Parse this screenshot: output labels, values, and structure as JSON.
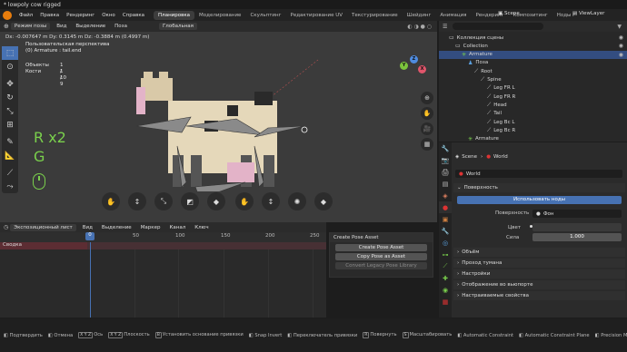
{
  "window": {
    "title": "* lowpoly cow rigged"
  },
  "menu": {
    "items": [
      "Файл",
      "Правка",
      "Рендеринг",
      "Окно",
      "Справка"
    ],
    "workspaces": [
      "Планировка",
      "Моделирование",
      "Скульптинг",
      "Редактирование UV",
      "Текстурирование",
      "Шейдинг",
      "Анимация",
      "Рендеринг",
      "Композитинг",
      "Ноды г"
    ],
    "active_workspace": "Планировка",
    "scene": "Scene",
    "view_layer": "ViewLayer"
  },
  "viewport": {
    "mode": "Режим позы",
    "menus": [
      "Вид",
      "Выделение",
      "Поза"
    ],
    "orientation": "Глобальная",
    "coords": "Dx: -0.007647 m   Dy: 0.3145 m  Dz: -0.3884 m (0.4997 m)",
    "perspective": "Пользовательская перспектива",
    "active": "(0) Armature : tail.end",
    "stats": [
      {
        "label": "Объекты",
        "value": "1 / 10"
      },
      {
        "label": "Кости",
        "value": "1 / 9"
      }
    ],
    "overlay_keys": [
      "R x2",
      "G"
    ],
    "gizmo_axes": [
      "X",
      "Y",
      "Z"
    ]
  },
  "timeline": {
    "menus": [
      "Экспозиционный лист",
      "Вид",
      "Выделение",
      "Маркер",
      "Канал",
      "Ключ"
    ],
    "frame_current": "0",
    "ruler_ticks": [
      "50",
      "100",
      "150",
      "200",
      "250"
    ],
    "channel": "Сводка"
  },
  "pose_panel": {
    "title": "Create Pose Asset",
    "buttons": [
      "Create Pose Asset",
      "Copy Pose as Asset",
      "Convert Legacy Pose Library"
    ]
  },
  "outliner": {
    "rows": [
      {
        "label": "Коллекция сцены",
        "icon": "collection-icon",
        "indent": 1
      },
      {
        "label": "Collection",
        "icon": "collection-icon",
        "indent": 2
      },
      {
        "label": "Armature",
        "icon": "armature-icon",
        "indent": 3,
        "selected": true
      },
      {
        "label": "Поза",
        "icon": "pose-icon",
        "indent": 4
      },
      {
        "label": "Root",
        "icon": "bone-icon",
        "indent": 5
      },
      {
        "label": "Spine",
        "icon": "bone-icon",
        "indent": 6
      },
      {
        "label": "Leg FR L",
        "icon": "bone-icon",
        "indent": 7
      },
      {
        "label": "Leg FR R",
        "icon": "bone-icon",
        "indent": 7
      },
      {
        "label": "Head",
        "icon": "bone-icon",
        "indent": 7
      },
      {
        "label": "Tail",
        "icon": "bone-icon",
        "indent": 7
      },
      {
        "label": "Leg Bc L",
        "icon": "bone-icon",
        "indent": 7
      },
      {
        "label": "Leg Bc R",
        "icon": "bone-icon",
        "indent": 7
      },
      {
        "label": "Armature",
        "icon": "armature-icon",
        "indent": 4
      }
    ]
  },
  "properties": {
    "scene_label": "Scene",
    "world_label": "World",
    "world_name": "World",
    "section_surface": "Поверхность",
    "use_nodes": "Использовать ноды",
    "surface_label": "Поверхность",
    "surface_value": "Фон",
    "color_label": "Цвет",
    "strength_label": "Сила",
    "strength_value": "1.000",
    "sections": [
      "Объём",
      "Проход тумана",
      "Настройки",
      "Отображение во вьюпорте",
      "Настраиваемые свойства"
    ]
  },
  "status": {
    "items": [
      {
        "key": "",
        "text": "Подтвердить"
      },
      {
        "key": "",
        "text": "Отмена"
      },
      {
        "key": "X Y Z",
        "text": "Ось"
      },
      {
        "key": "X Y Z",
        "text": "Плоскость"
      },
      {
        "key": "B",
        "text": "Установить основание привязки"
      },
      {
        "key": "",
        "text": "Snap Invert"
      },
      {
        "key": "",
        "text": "Переключатель привязки"
      },
      {
        "key": "R",
        "text": "Повернуть"
      },
      {
        "key": "S",
        "text": "Масштабировать"
      },
      {
        "key": "",
        "text": "Automatic Constraint"
      },
      {
        "key": "",
        "text": "Automatic Constraint Plane"
      },
      {
        "key": "",
        "text": "Precision M"
      }
    ]
  },
  "colors": {
    "accent": "#4772b3",
    "selected_row": "#334d80",
    "overlay_text": "#7ad04c"
  }
}
